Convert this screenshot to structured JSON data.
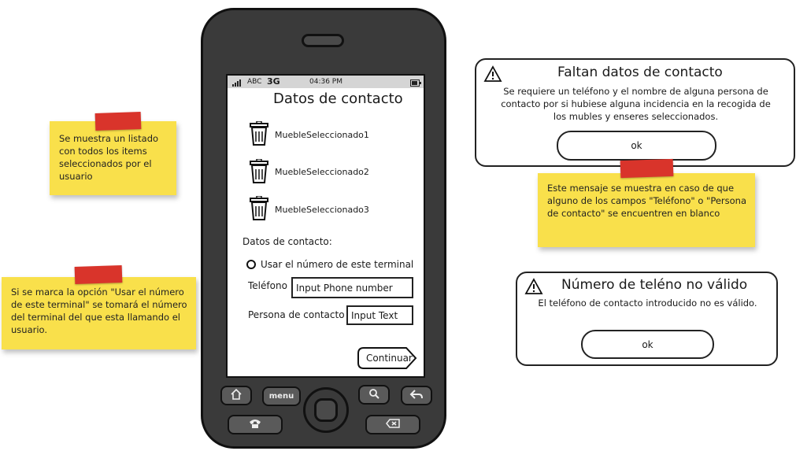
{
  "notes": {
    "listado": "Se muestra un listado con todos los items seleccionados por el usuario",
    "terminal": "Si se marca la opción \"Usar el número de este terminal\" se tomará el número del terminal del que esta llamando el usuario.",
    "mensaje": "Este mensaje se muestra en caso de que alguno de los campos \"Teléfono\" o \"Persona de contacto\" se encuentren en blanco"
  },
  "status": {
    "carrier": "ABC",
    "network": "3G",
    "time": "04:36 PM"
  },
  "screen": {
    "title": "Datos de contacto",
    "items": [
      {
        "label": "MuebleSeleccionado1",
        "icon": "trash-icon"
      },
      {
        "label": "MuebleSeleccionado2",
        "icon": "trash-icon"
      },
      {
        "label": "MuebleSeleccionado3",
        "icon": "trash-icon"
      }
    ],
    "section_label": "Datos de contacto:",
    "radio_label": "Usar el número de este terminal",
    "phone_label": "Teléfono",
    "phone_value": "Input Phone number",
    "contact_label": "Persona de contacto",
    "contact_value": "Input Text",
    "continue_label": "Continuar"
  },
  "hardware": {
    "menu_label": "menu"
  },
  "dialog_missing": {
    "title": "Faltan datos de contacto",
    "text": "Se requiere un teléfono y el nombre de alguna persona de contacto por si hubiese alguna incidencia en la recogida de los mubles y enseres seleccionados.",
    "ok": "ok"
  },
  "dialog_invalid": {
    "title": "Número de teléno no válido",
    "text": "El teléfono de contacto introducido no es válido.",
    "ok": "ok"
  }
}
